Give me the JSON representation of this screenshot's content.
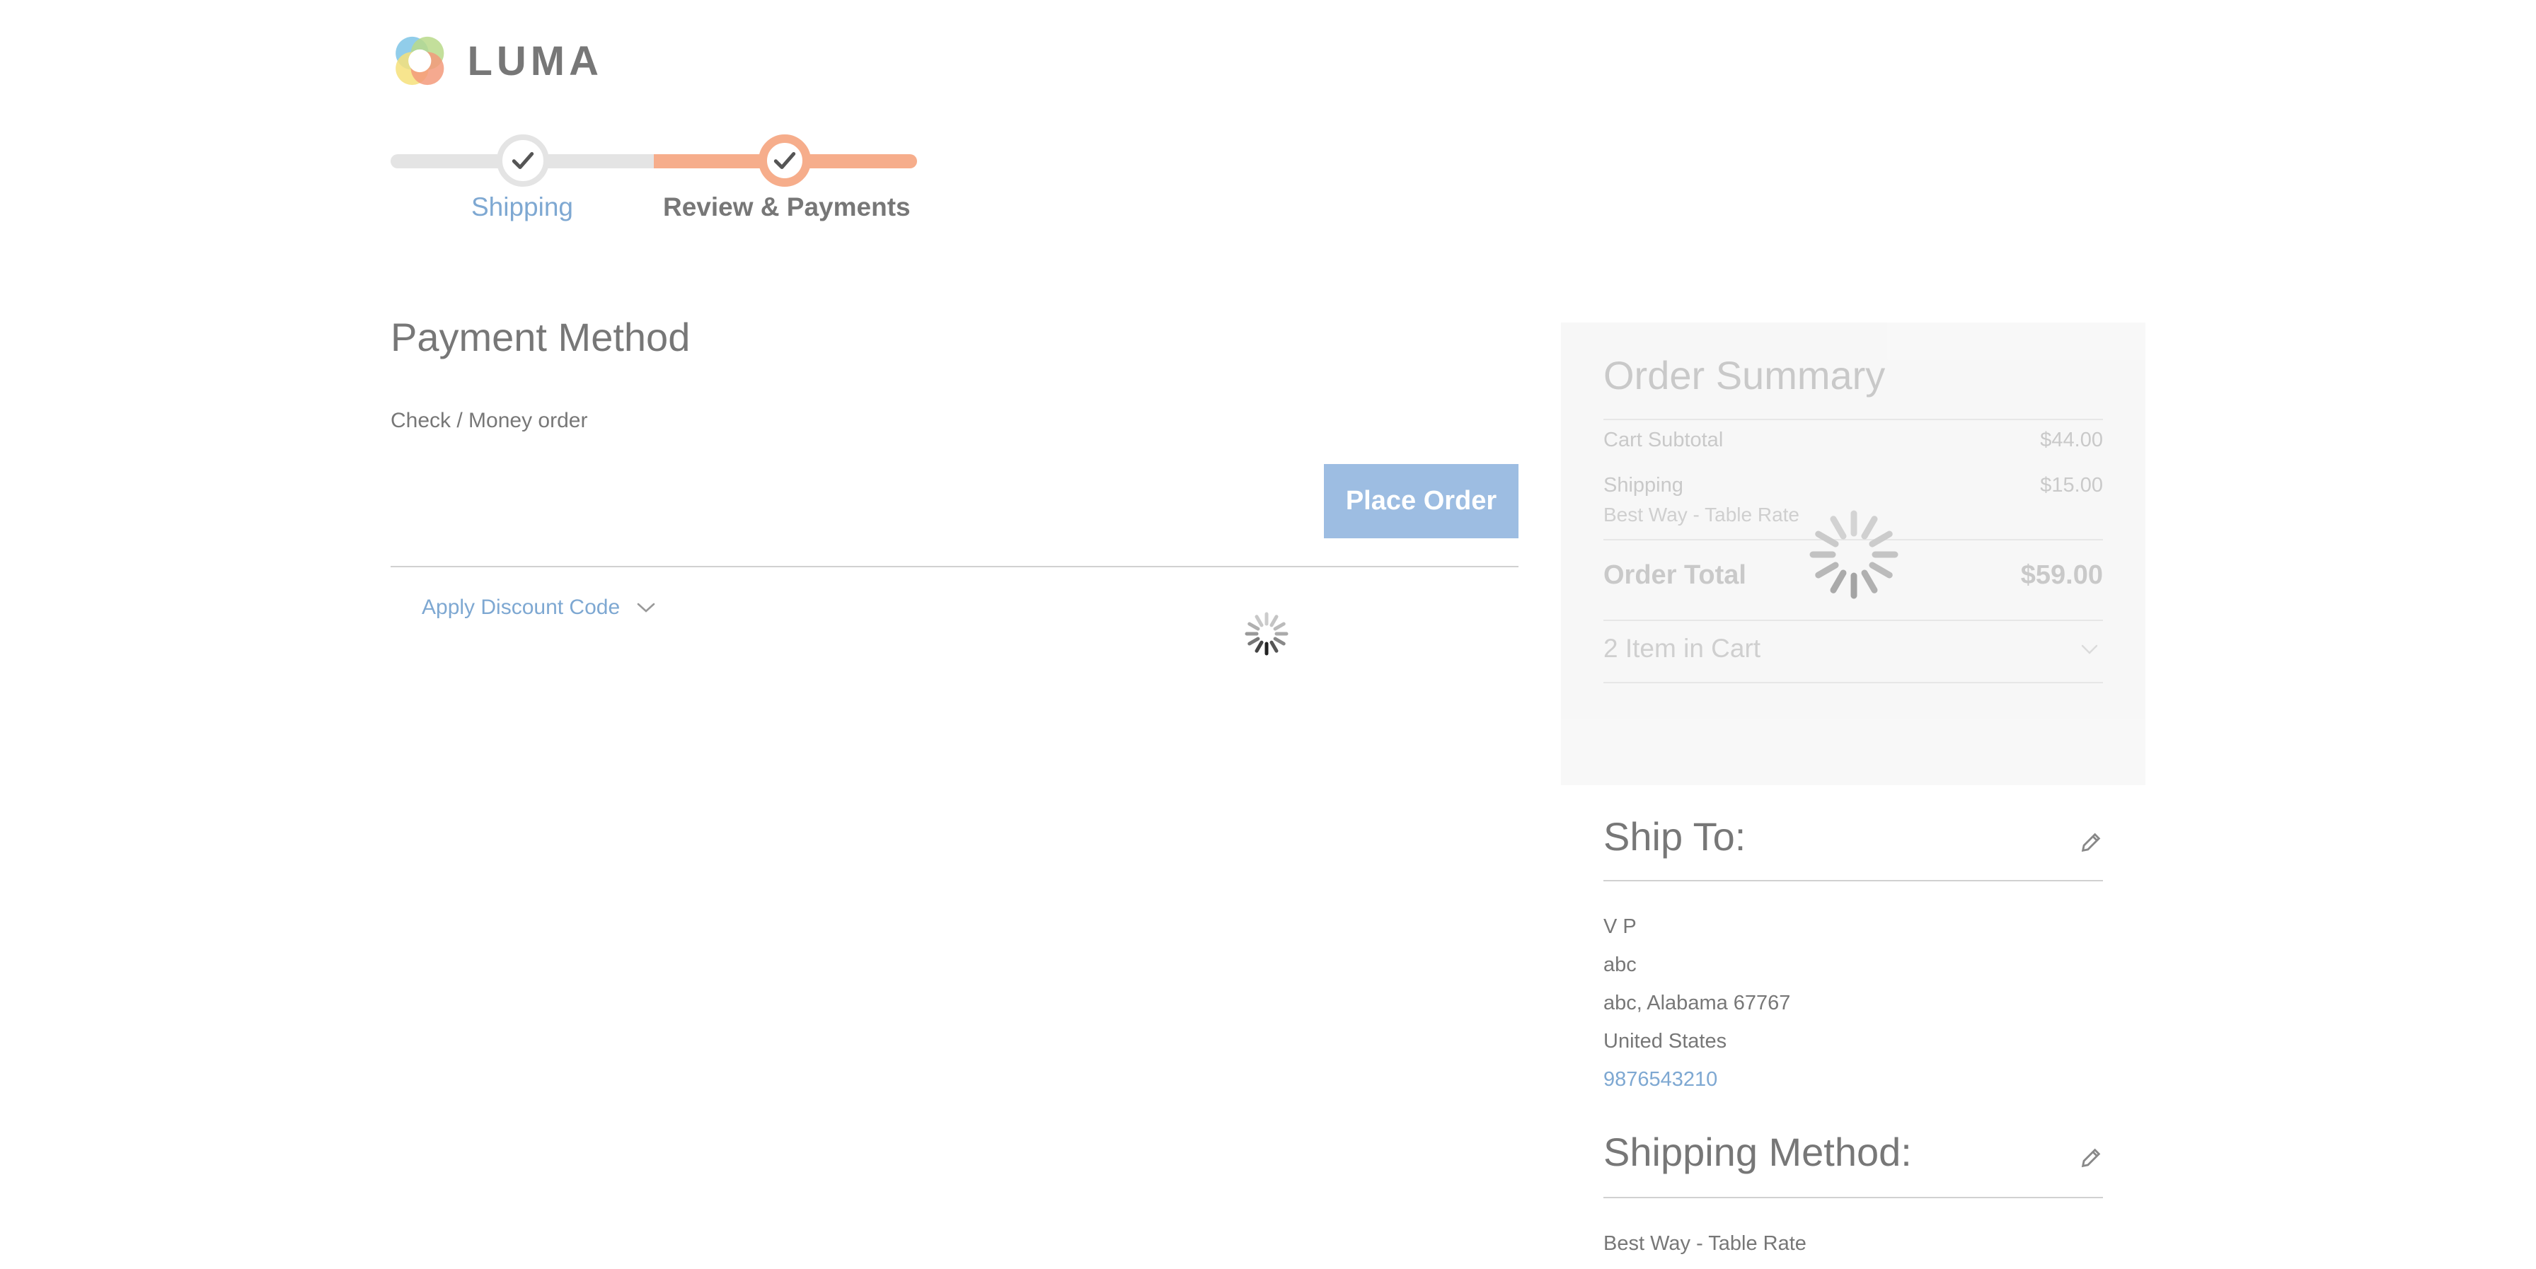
{
  "logo": {
    "text": "LUMA"
  },
  "progress": {
    "steps": [
      {
        "label": "Shipping",
        "state": "completed"
      },
      {
        "label": "Review & Payments",
        "state": "active"
      }
    ]
  },
  "payment": {
    "title": "Payment Method",
    "selected_method": "Check / Money order",
    "place_order_label": "Place Order",
    "discount_label": "Apply Discount Code"
  },
  "summary": {
    "title": "Order Summary",
    "cart_subtotal_label": "Cart Subtotal",
    "cart_subtotal_value": "$44.00",
    "shipping_label": "Shipping",
    "shipping_value": "$15.00",
    "shipping_method_name": "Best Way - Table Rate",
    "order_total_label": "Order Total",
    "order_total_value": "$59.00",
    "items_in_cart": "2 Item in Cart"
  },
  "ship_to": {
    "title": "Ship To:",
    "name": "V P",
    "street": "abc",
    "city_line": "abc, Alabama 67767",
    "country": "United States",
    "phone": "9876543210"
  },
  "shipping_method": {
    "title": "Shipping Method:",
    "value": "Best Way - Table Rate"
  },
  "colors": {
    "accent_orange": "#f6ad8b",
    "link_blue": "#7ea8d2",
    "button_blue": "#9dbde2",
    "text_gray": "#777777"
  }
}
